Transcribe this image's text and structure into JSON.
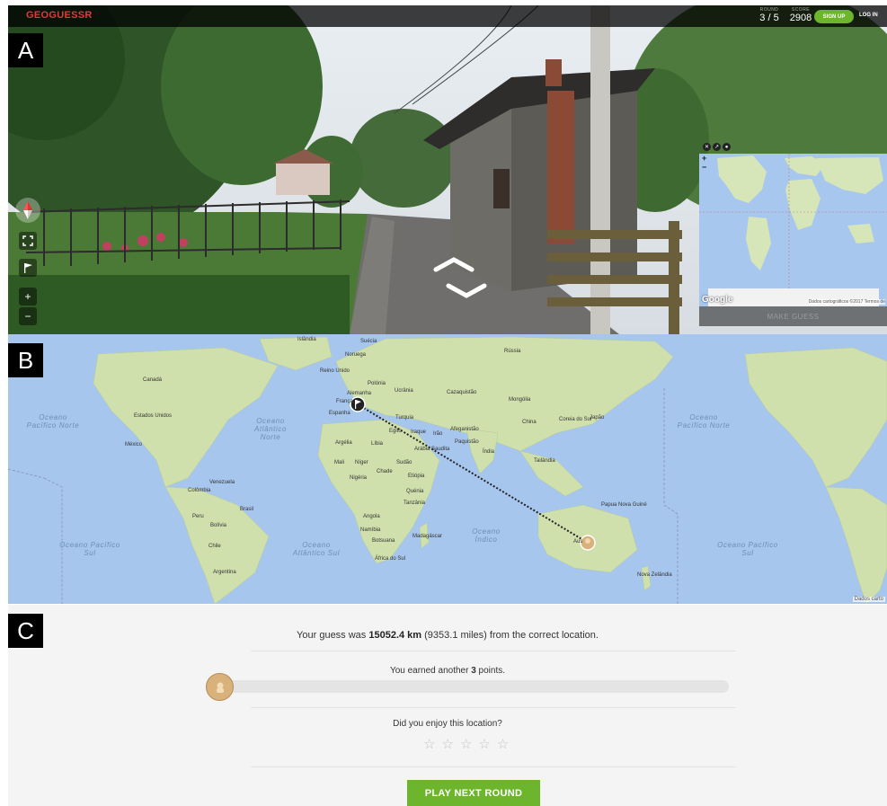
{
  "labels": {
    "a": "A",
    "b": "B",
    "c": "C"
  },
  "topbar": {
    "logo": "GEOGUESSR",
    "round_label": "ROUND",
    "round_value": "3 / 5",
    "score_label": "SCORE",
    "score_value": "2908",
    "signup": "SIGN UP",
    "login": "LOG IN"
  },
  "minimap": {
    "google": "Google",
    "attribution": "Dados cartográficos ©2017   Termos de",
    "make_guess": "MAKE GUESS",
    "zoom_in": "+",
    "zoom_out": "−"
  },
  "streetview_controls": {
    "zoom_in": "+",
    "zoom_out": "−"
  },
  "world_map": {
    "countries": [
      "Islândia",
      "Suécia",
      "Rússia",
      "Noruega",
      "Reino Unido",
      "Polónia",
      "Ucrânia",
      "Alemanha",
      "França",
      "Cazaquistão",
      "Mongólia",
      "Espanha",
      "Turquia",
      "Irão",
      "Iraque",
      "Afeganistão",
      "China",
      "Coreia do Sul",
      "Japão",
      "Paquistão",
      "Arábia Saudita",
      "Índia",
      "Egito",
      "Líbia",
      "Argélia",
      "Mali",
      "Níger",
      "Chade",
      "Sudão",
      "Nigéria",
      "Etiópia",
      "Quénia",
      "Tanzânia",
      "Angola",
      "Namíbia",
      "Botsuana",
      "Madagáscar",
      "África do Sul",
      "Tailândia",
      "Papua Nova Guiné",
      "Nova Zelândia",
      "Canadá",
      "Estados Unidos",
      "México",
      "Venezuela",
      "Colômbia",
      "Brasil",
      "Peru",
      "Bolívia",
      "Chile",
      "Argentina",
      "Aus"
    ],
    "oceans": {
      "pac_north_left": "Oceano Pacífico Norte",
      "atl_north": "Oceano Atlântico Norte",
      "pac_north_right": "Oceano Pacífico Norte",
      "pac_south_left": "Oceano Pacífico Sul",
      "atl_south": "Oceano Atlântico Sul",
      "indian": "Oceano Índico",
      "pac_south_right": "Oceano Pacífico Sul"
    },
    "attribution": "Dados carto"
  },
  "result": {
    "prefix": "Your guess was ",
    "distance_km": "15052.4 km",
    "suffix": " (9353.1 miles) from the correct location.",
    "earned_prefix": "You earned another ",
    "points": "3",
    "earned_suffix": " points.",
    "progress_fraction": 0.0006,
    "enjoy": "Did you enjoy this location?",
    "star_count": 5,
    "play_next": "PLAY NEXT ROUND"
  },
  "colors": {
    "accent_green": "#6cb52d",
    "logo_red": "#e23a3a",
    "ocean": "#a6c6ed",
    "land": "#cfe0ad"
  }
}
